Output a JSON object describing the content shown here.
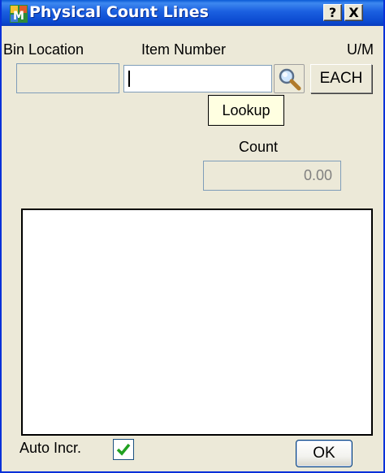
{
  "window": {
    "title": "Physical Count Lines",
    "help_label": "?",
    "close_label": "X",
    "icon": "app-icon"
  },
  "fields": {
    "bin_location_label": "Bin Location",
    "item_number_label": "Item Number",
    "um_label": "U/M",
    "um_value": "EACH",
    "item_number_value": "",
    "lookup_icon": "magnifier-icon",
    "lookup_tooltip": "Lookup",
    "count_label": "Count",
    "count_value": "0.00"
  },
  "footer": {
    "auto_incr_label": "Auto Incr.",
    "auto_incr_checked": true,
    "ok_label": "OK"
  }
}
